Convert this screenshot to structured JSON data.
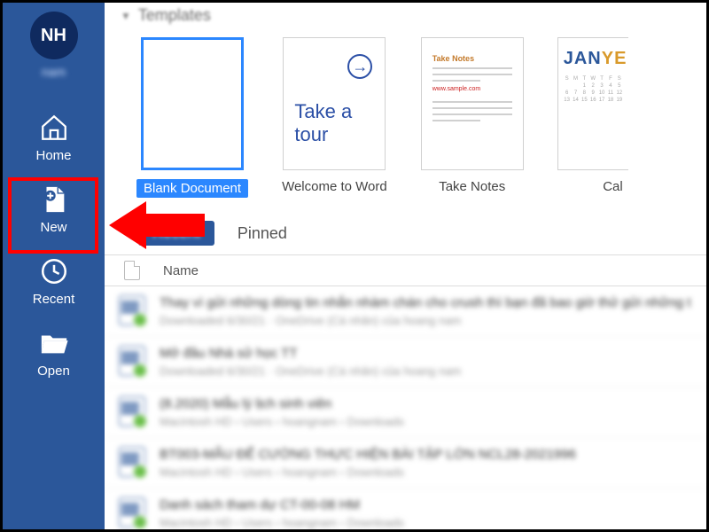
{
  "sidebar": {
    "avatar_initials": "NH",
    "avatar_name": "nam",
    "items": [
      {
        "label": "Home"
      },
      {
        "label": "New"
      },
      {
        "label": "Recent"
      },
      {
        "label": "Open"
      }
    ]
  },
  "templates": {
    "header": "Templates",
    "items": [
      {
        "label": "Blank Document",
        "selected": true
      },
      {
        "label": "Welcome to Word",
        "tour_line1": "Take a",
        "tour_line2": "tour"
      },
      {
        "label": "Take Notes",
        "tn_title": "Take Notes"
      },
      {
        "label": "Cal",
        "cal_text": "JANYE"
      }
    ]
  },
  "tabs": {
    "recent": "Recent",
    "pinned": "Pinned"
  },
  "table": {
    "name_header": "Name"
  },
  "files": [
    {
      "title": "Thay vì gửi những dòng tin nhắn nhàm chán cho crush thì bạn đã bao giờ thử gửi những t",
      "sub": "Downloaded 6/30/21 · OneDrive (Cá nhân) của hoang nam"
    },
    {
      "title": "Mở đầu Nhà sử học TT",
      "sub": "Downloaded 6/30/21 · OneDrive (Cá nhân) của hoang nam"
    },
    {
      "title": "(8.2020) Mẫu lý lịch sinh viên",
      "sub": "Macintosh HD › Users › hoangnam › Downloads"
    },
    {
      "title": "BT003-MẪU ĐỂ CƯỜNG THỰC HIỆN BÀI TẬP LỚN NCL28-2021996",
      "sub": "Macintosh HD › Users › hoangnam › Downloads"
    },
    {
      "title": "Danh sách tham dự CT-00-08 HM",
      "sub": "Macintosh HD › Users › hoangnam › Downloads"
    }
  ]
}
